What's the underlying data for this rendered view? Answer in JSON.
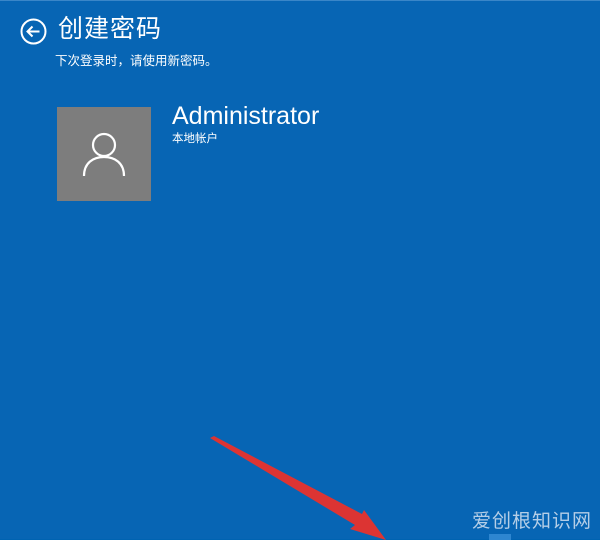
{
  "header": {
    "title": "创建密码",
    "subtitle": "下次登录时，请使用新密码。",
    "back_icon": "back-arrow-circle-icon"
  },
  "account": {
    "name": "Administrator",
    "type": "本地帐户",
    "avatar_icon": "user-silhouette-icon"
  },
  "annotation": {
    "arrow_icon": "red-pointer-arrow",
    "color": "#e8322c"
  },
  "watermark": {
    "text": "爱创根知识网"
  },
  "colors": {
    "background": "#0765b4",
    "avatar_background": "#7d7d7d",
    "text": "#ffffff"
  }
}
